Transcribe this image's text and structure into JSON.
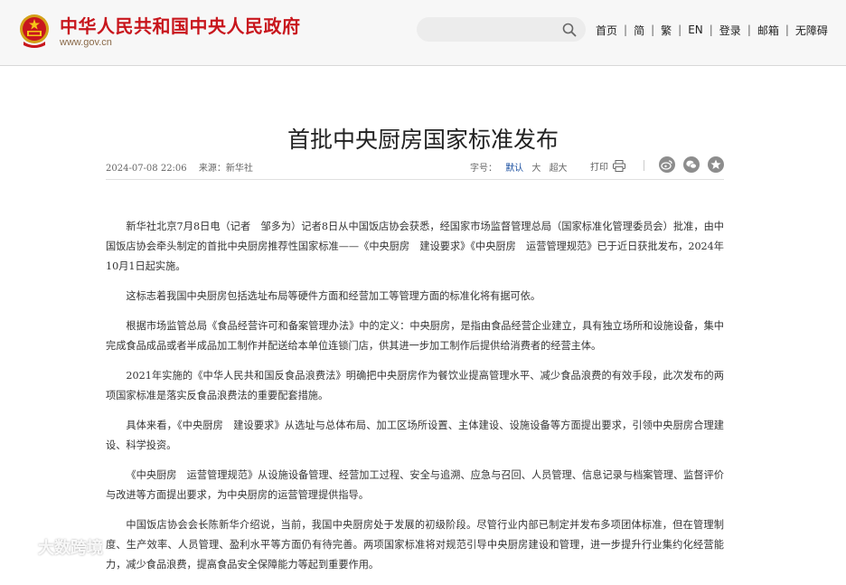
{
  "header": {
    "site_title": "中华人民共和国中央人民政府",
    "site_domain": "www.gov.cn",
    "search_placeholder": "",
    "nav": [
      "首页",
      "简",
      "繁",
      "EN",
      "登录",
      "邮箱",
      "无障碍"
    ],
    "brand_color": "#c8161d"
  },
  "article": {
    "title": "首批中央厨房国家标准发布",
    "datetime": "2024-07-08 22:06",
    "source": "来源：新华社",
    "font_size_label": "字号：",
    "font_size_options": [
      "默认",
      "大",
      "超大"
    ],
    "print_label": "打印",
    "share_icons": [
      "weibo-icon",
      "wechat-icon",
      "favorite-icon"
    ],
    "paragraphs": [
      "新华社北京7月8日电（记者　邹多为）记者8日从中国饭店协会获悉，经国家市场监督管理总局（国家标准化管理委员会）批准，由中国饭店协会牵头制定的首批中央厨房推荐性国家标准——《中央厨房　建设要求》《中央厨房　运营管理规范》已于近日获批发布，2024年10月1日起实施。",
      "这标志着我国中央厨房包括选址布局等硬件方面和经营加工等管理方面的标准化将有据可依。",
      "根据市场监管总局《食品经营许可和备案管理办法》中的定义：中央厨房，是指由食品经营企业建立，具有独立场所和设施设备，集中完成食品成品或者半成品加工制作并配送给本单位连锁门店，供其进一步加工制作后提供给消费者的经营主体。",
      "2021年实施的《中华人民共和国反食品浪费法》明确把中央厨房作为餐饮业提高管理水平、减少食品浪费的有效手段，此次发布的两项国家标准是落实反食品浪费法的重要配套措施。",
      "具体来看，《中央厨房　建设要求》从选址与总体布局、加工区场所设置、主体建设、设施设备等方面提出要求，引领中央厨房合理建设、科学投资。",
      "《中央厨房　运营管理规范》从设施设备管理、经营加工过程、安全与追溯、应急与召回、人员管理、信息记录与档案管理、监督评价与改进等方面提出要求，为中央厨房的运营管理提供指导。",
      "中国饭店协会会长陈新华介绍说，当前，我国中央厨房处于发展的初级阶段。尽管行业内部已制定并发布多项团体标准，但在管理制度、生产效率、人员管理、盈利水平等方面仍有待完善。两项国家标准将对规范引导中央厨房建设和管理，进一步提升行业集约化经营能力，减少食品浪费，提高食品安全保障能力等起到重要作用。"
    ]
  },
  "watermark": "大数跨境"
}
